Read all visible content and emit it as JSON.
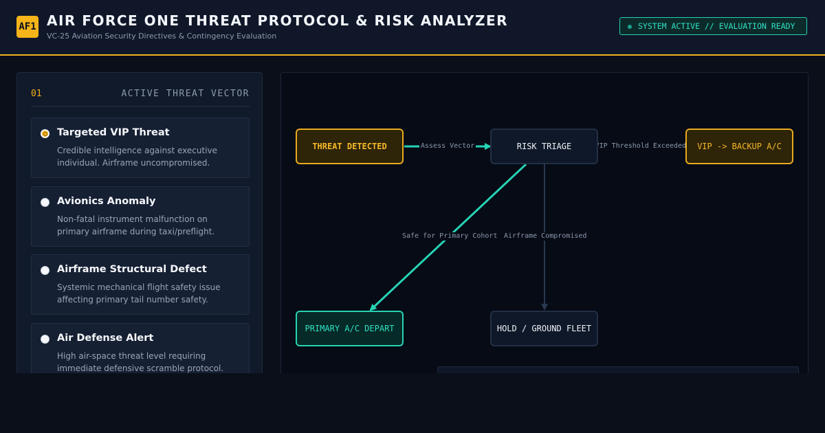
{
  "header": {
    "logo": "AF1",
    "title": "AIR FORCE ONE THREAT PROTOCOL & RISK ANALYZER",
    "subtitle": "VC-25 Aviation Security Directives & Contingency Evaluation",
    "status": "SYSTEM ACTIVE // EVALUATION READY"
  },
  "panel": {
    "number": "01",
    "label": "ACTIVE THREAT VECTOR",
    "options": [
      {
        "title": "Targeted VIP Threat",
        "desc": "Credible intelligence against executive individual. Airframe uncompromised.",
        "selected": true
      },
      {
        "title": "Avionics Anomaly",
        "desc": "Non-fatal instrument malfunction on primary airframe during taxi/preflight.",
        "selected": false
      },
      {
        "title": "Airframe Structural Defect",
        "desc": "Systemic mechanical flight safety issue affecting primary tail number safety.",
        "selected": false
      },
      {
        "title": "Air Defense Alert",
        "desc": "High air-space threat level requiring immediate defensive scramble protocol.",
        "selected": false
      }
    ]
  },
  "diagram": {
    "nodes": {
      "threat": "THREAT DETECTED",
      "triage": "RISK TRIAGE",
      "backup": "VIP -> BACKUP A/C",
      "primary": "PRIMARY A/C DEPART",
      "hold": "HOLD / GROUND FLEET"
    },
    "edges": {
      "assess": "Assess Vector",
      "vip": "VIP Threshold Exceeded",
      "safe": "Safe for Primary Cohort",
      "compromised": "Airframe Compromised"
    }
  },
  "colors": {
    "accent": "#f5b419",
    "teal": "#27d3b5",
    "background": "#0a0f1a"
  }
}
